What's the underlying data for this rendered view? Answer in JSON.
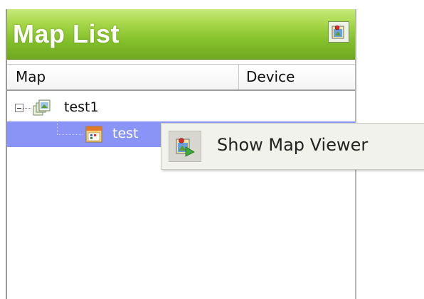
{
  "panel": {
    "title": "Map List",
    "title_button_icon": "map-viewer-icon"
  },
  "table": {
    "columns": [
      "Map",
      "Device"
    ]
  },
  "tree": {
    "nodes": [
      {
        "label": "test1",
        "icon": "map-group-icon",
        "expanded": true
      },
      {
        "label": "test",
        "icon": "map-calendar-icon",
        "selected": true
      }
    ]
  },
  "context_menu": {
    "items": [
      {
        "label": "Show Map Viewer",
        "icon": "show-map-viewer-icon"
      }
    ]
  },
  "colors": {
    "title_bar": "#86c22c",
    "selection": "#8a93f6",
    "menu_background": "#f2f2ec"
  }
}
